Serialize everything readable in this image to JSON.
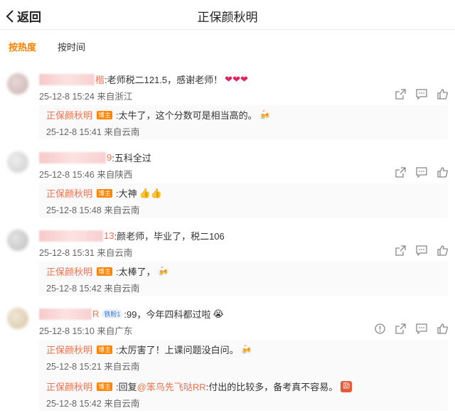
{
  "header": {
    "back_label": "返回",
    "title": "正保颜秋明"
  },
  "sort_tabs": [
    {
      "label": "按热度",
      "active": true
    },
    {
      "label": "按时间",
      "active": false
    }
  ],
  "comments": [
    {
      "name_tail": "楷",
      "text": ":老师税二121.5，感谢老师！",
      "emoji": "❤❤❤",
      "time": "25-12-8 15:24",
      "location": "来自浙江",
      "replies": [
        {
          "author": "正保颜秋明",
          "badge": "博主",
          "text": ":太牛了，这个分数可是相当高的。",
          "emoji": "🍻",
          "time": "25-12-8 15:41",
          "location": "来自云南"
        }
      ]
    },
    {
      "name_tail": "9",
      "text": ":五科全过",
      "emoji": "",
      "time": "25-12-8 15:46",
      "location": "来自陕西",
      "replies": [
        {
          "author": "正保颜秋明",
          "badge": "博主",
          "text": ":大神",
          "emoji": "👍👍",
          "time": "25-12-8 15:48",
          "location": "来自云南"
        }
      ]
    },
    {
      "name_tail": "13",
      "text": ":颜老师，毕业了，税二106",
      "emoji": "",
      "time": "25-12-8 15:31",
      "location": "来自云南",
      "replies": [
        {
          "author": "正保颜秋明",
          "badge": "博主",
          "text": ":太棒了，",
          "emoji": "🍻",
          "time": "25-12-8 15:42",
          "location": "来自云南"
        }
      ]
    },
    {
      "name_tail": "R",
      "vip": "铁粉1",
      "text": ":99，今年四科都过啦",
      "emoji": "😭",
      "time": "25-12-8 15:10",
      "location": "来自广东",
      "replies": [
        {
          "author": "正保颜秋明",
          "badge": "博主",
          "text": ":太厉害了！上课问题没白问。",
          "emoji": "🍻",
          "time": "25-12-8 15:21",
          "location": "来自云南"
        },
        {
          "author": "正保颜秋明",
          "badge": "博主",
          "text_pre": ":回复",
          "mention": "@笨鸟先飞哒RR",
          "text_post": ":付出的比较多，备考真不容易。",
          "tag": "励",
          "time": "25-12-8 15:42",
          "location": "来自云南"
        }
      ]
    }
  ],
  "colors": {
    "accent": "#ff8200",
    "name": "#eb7350",
    "meta": "#666666"
  }
}
